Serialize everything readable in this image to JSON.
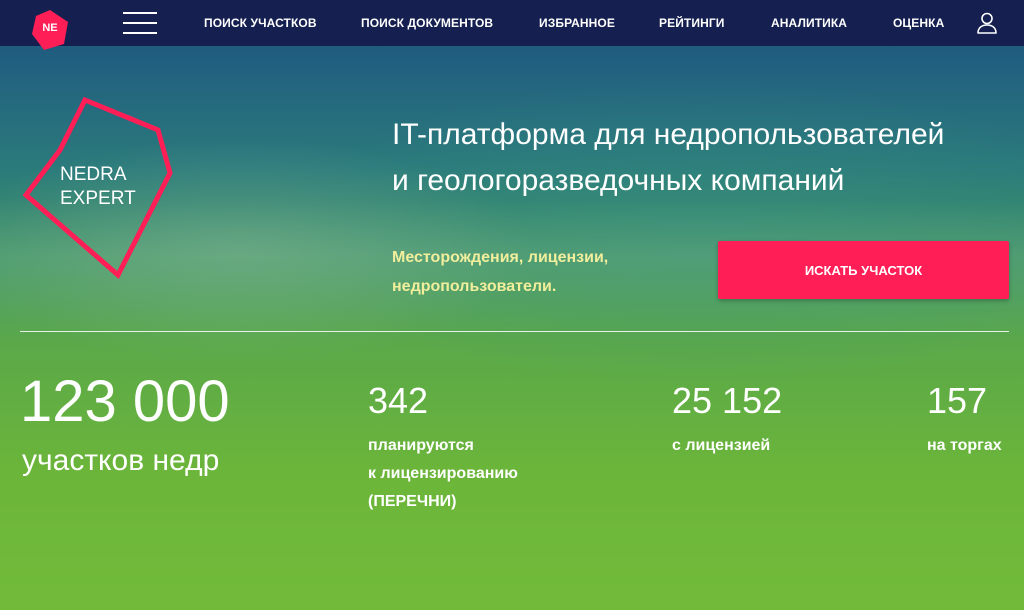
{
  "nav": {
    "logo_text": "NE",
    "items": [
      "ПОИСК УЧАСТКОВ",
      "ПОИСК ДОКУМЕНТОВ",
      "ИЗБРАННОЕ",
      "РЕЙТИНГИ",
      "АНАЛИТИКА",
      "ОЦЕНКА"
    ]
  },
  "brand": {
    "line1": "NEDRA",
    "line2": "EXPERT",
    "accent_color": "#ff1e56"
  },
  "hero": {
    "title_line1": "IT-платформа для недропользователей",
    "title_line2": "и геологоразведочных компаний",
    "subtitle_line1": "Месторождения, лицензии,",
    "subtitle_line2": "недропользователи.",
    "cta_label": "ИСКАТЬ УЧАСТОК"
  },
  "stats": {
    "total": {
      "value": "123 000",
      "label": "участков недр"
    },
    "planned": {
      "value": "342",
      "label_line1": "планируются",
      "label_line2": "к лицензированию",
      "label_line3": "(ПЕРЕЧНИ)"
    },
    "licensed": {
      "value": "25 152",
      "label": "с лицензией"
    },
    "auction": {
      "value": "157",
      "label": "на торгах"
    }
  },
  "icons": {
    "menu": "hamburger-menu-icon",
    "user": "user-icon"
  }
}
